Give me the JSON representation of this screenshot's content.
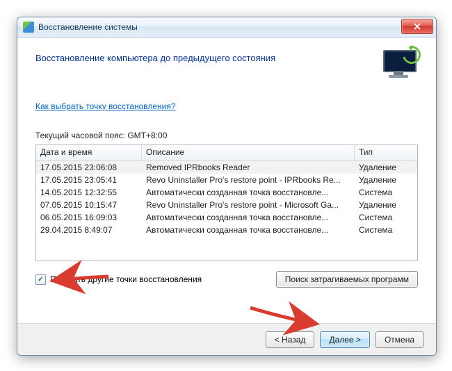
{
  "window": {
    "title": "Восстановление системы"
  },
  "header": {
    "heading": "Восстановление компьютера до предыдущего состояния"
  },
  "link": {
    "help": "Как выбрать точку восстановления?"
  },
  "tz": {
    "label": "Текущий часовой пояс: GMT+8:00"
  },
  "table": {
    "columns": {
      "datetime": "Дата и время",
      "description": "Описание",
      "type": "Тип"
    },
    "rows": [
      {
        "dt": "17.05.2015 23:06:08",
        "desc": "Removed IPRbooks Reader",
        "type": "Удаление"
      },
      {
        "dt": "17.05.2015 23:05:41",
        "desc": "Revo Uninstaller Pro's restore point - IPRbooks Re...",
        "type": "Удаление"
      },
      {
        "dt": "14.05.2015 12:32:55",
        "desc": "Автоматически созданная точка восстановле...",
        "type": "Система"
      },
      {
        "dt": "07.05.2015 10:15:47",
        "desc": "Revo Uninstaller Pro's restore point - Microsoft Ga...",
        "type": "Удаление"
      },
      {
        "dt": "06.05.2015 16:09:03",
        "desc": "Автоматически созданная точка восстановле...",
        "type": "Система"
      },
      {
        "dt": "29.04.2015 8:49:07",
        "desc": "Автоматически созданная точка восстановле...",
        "type": "Система"
      }
    ]
  },
  "checkbox": {
    "label": "Показать другие точки восстановления",
    "checked": true
  },
  "buttons": {
    "affected": "Поиск затрагиваемых программ",
    "back": "< Назад",
    "next": "Далее >",
    "cancel": "Отмена"
  }
}
